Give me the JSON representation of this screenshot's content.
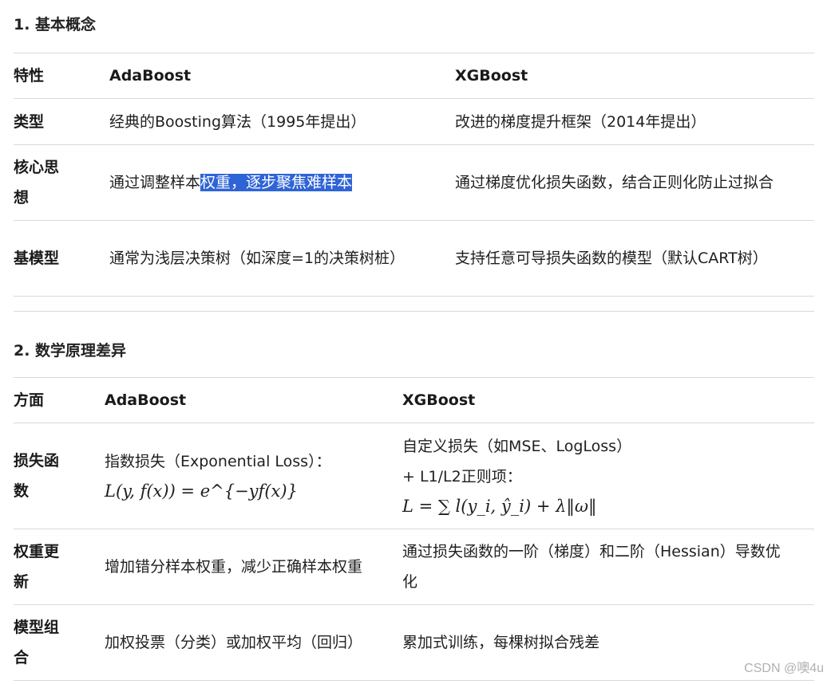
{
  "section1": {
    "title": "1. 基本概念",
    "headers": [
      "特性",
      "AdaBoost",
      "XGBoost"
    ],
    "rows": [
      {
        "label": "类型",
        "ada": "经典的Boosting算法（1995年提出）",
        "xgb": "改进的梯度提升框架（2014年提出）"
      },
      {
        "label": "核心思想",
        "ada_plain": "通过调整样本",
        "ada_highlight": "权重，逐步聚焦难样本",
        "xgb": "通过梯度优化损失函数，结合正则化防止过拟合"
      },
      {
        "label": "基模型",
        "ada": "通常为浅层决策树（如深度=1的决策树桩）",
        "xgb": "支持任意可导损失函数的模型（默认CART树）"
      }
    ]
  },
  "section2": {
    "title": "2. 数学原理差异",
    "headers": [
      "方面",
      "AdaBoost",
      "XGBoost"
    ],
    "rows": [
      {
        "label": "损失函数",
        "ada": "指数损失（Exponential Loss）：",
        "ada_formula": "L(y, f(x)) = e^{−yf(x)}",
        "xgb_line1": "自定义损失（如MSE、LogLoss）",
        "xgb_line2": "+ L1/L2正则项：",
        "xgb_formula": "L = ∑ l(y_i, ŷ_i) + λ‖ω‖"
      },
      {
        "label": "权重更新",
        "ada": "增加错分样本权重，减少正确样本权重",
        "xgb": "通过损失函数的一阶（梯度）和二阶（Hessian）导数优化"
      },
      {
        "label": "模型组合",
        "ada": "加权投票（分类）或加权平均（回归）",
        "xgb": "累加式训练，每棵树拟合残差"
      }
    ]
  },
  "watermark": "CSDN @噢4u"
}
